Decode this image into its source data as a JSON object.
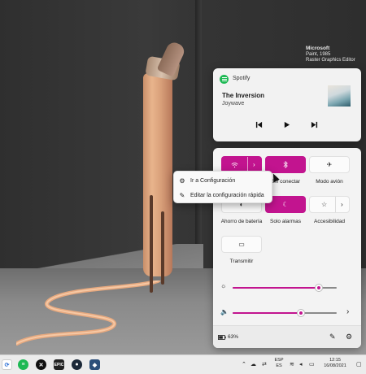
{
  "wallpaper_caption": {
    "title": "Microsoft",
    "line2": "Paint, 1985",
    "line3": "Raster Graphics Editor"
  },
  "media": {
    "app_name": "Spotify",
    "track_title": "The Inversion",
    "artist": "Joywave",
    "icons": [
      "spotify-icon",
      "previous-icon",
      "play-icon",
      "next-icon"
    ]
  },
  "quick_settings": {
    "tiles": [
      {
        "label": "",
        "icon": "wifi-icon",
        "on": true
      },
      {
        "label": "Sin conectar",
        "icon": "bluetooth-icon",
        "on": true
      },
      {
        "label": "Modo avión",
        "icon": "airplane-icon",
        "on": false
      },
      {
        "label": "Ahorro de batería",
        "icon": "battery-saver-icon",
        "on": false
      },
      {
        "label": "Solo alarmas",
        "icon": "focus-assist-icon",
        "on": true
      },
      {
        "label": "Accesibilidad",
        "icon": "accessibility-icon",
        "on": false
      },
      {
        "label": "Transmitir",
        "icon": "cast-icon",
        "on": false
      }
    ],
    "brightness": 0.83,
    "volume": 0.66,
    "battery": "63%"
  },
  "context_menu": {
    "items": [
      {
        "label": "Ir a Configuración",
        "icon": "gear-icon"
      },
      {
        "label": "Editar la configuración rápida",
        "icon": "pencil-icon"
      }
    ]
  },
  "taskbar": {
    "language_top": "ESP",
    "language_bottom": "ES",
    "time": "12:15",
    "date": "16/08/2021",
    "colors": {
      "accent": "#c2148f",
      "spotify": "#1db954"
    }
  }
}
